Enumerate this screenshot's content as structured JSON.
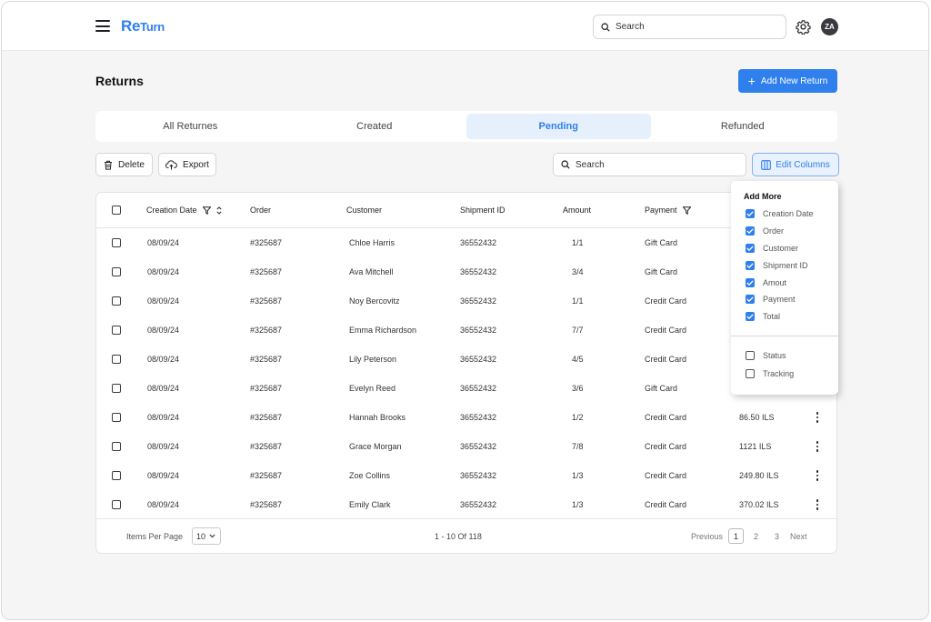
{
  "app": {
    "logo_main": "Re",
    "logo_small": "Turn"
  },
  "header": {
    "search_placeholder": "Search",
    "avatar_initials": "ZA"
  },
  "page": {
    "title": "Returns",
    "add_button_label": "Add New Return"
  },
  "tabs": [
    {
      "label": "All Returnes",
      "active": false
    },
    {
      "label": "Created",
      "active": false
    },
    {
      "label": "Pending",
      "active": true
    },
    {
      "label": "Refunded",
      "active": false
    }
  ],
  "toolbar": {
    "delete_label": "Delete",
    "export_label": "Export",
    "search_placeholder": "Search",
    "edit_columns_label": "Edit Columns"
  },
  "table": {
    "columns": {
      "creation_date": "Creation Date",
      "order": "Order",
      "customer": "Customer",
      "shipment_id": "Shipment ID",
      "amount": "Amount",
      "payment": "Payment"
    },
    "rows": [
      {
        "date": "08/09/24",
        "order": "#325687",
        "customer": "Chloe Harris",
        "shipment": "36552432",
        "amount": "1/1",
        "payment": "Gift Card",
        "total": ""
      },
      {
        "date": "08/09/24",
        "order": "#325687",
        "customer": "Ava Mitchell",
        "shipment": "36552432",
        "amount": "3/4",
        "payment": "Gift Card",
        "total": ""
      },
      {
        "date": "08/09/24",
        "order": "#325687",
        "customer": "Noy Bercovitz",
        "shipment": "36552432",
        "amount": "1/1",
        "payment": "Credit Card",
        "total": ""
      },
      {
        "date": "08/09/24",
        "order": "#325687",
        "customer": "Emma Richardson",
        "shipment": "36552432",
        "amount": "7/7",
        "payment": "Credit Card",
        "total": ""
      },
      {
        "date": "08/09/24",
        "order": "#325687",
        "customer": "Lily Peterson",
        "shipment": "36552432",
        "amount": "4/5",
        "payment": "Credit Card",
        "total": ""
      },
      {
        "date": "08/09/24",
        "order": "#325687",
        "customer": "Evelyn Reed",
        "shipment": "36552432",
        "amount": "3/6",
        "payment": "Gift Card",
        "total": ""
      },
      {
        "date": "08/09/24",
        "order": "#325687",
        "customer": "Hannah Brooks",
        "shipment": "36552432",
        "amount": "1/2",
        "payment": "Credit Card",
        "total": "86.50 ILS"
      },
      {
        "date": "08/09/24",
        "order": "#325687",
        "customer": "Grace Morgan",
        "shipment": "36552432",
        "amount": "7/8",
        "payment": "Credit Card",
        "total": "1121 ILS"
      },
      {
        "date": "08/09/24",
        "order": "#325687",
        "customer": "Zoe Collins",
        "shipment": "36552432",
        "amount": "1/3",
        "payment": "Credit Card",
        "total": "249.80 ILS"
      },
      {
        "date": "08/09/24",
        "order": "#325687",
        "customer": "Emily Clark",
        "shipment": "36552432",
        "amount": "1/3",
        "payment": "Credit Card",
        "total": "370.02 ILS"
      }
    ]
  },
  "footer": {
    "items_per_page_label": "Items Per Page",
    "items_per_page_value": "10",
    "range_text": "1 - 10 Of 118",
    "previous_label": "Previous",
    "pages": [
      "1",
      "2",
      "3"
    ],
    "current_page": "1",
    "next_label": "Next"
  },
  "column_menu": {
    "title": "Add More",
    "checked": [
      "Creation Date",
      "Order",
      "Customer",
      "Shipment ID",
      "Amout",
      "Payment",
      "Total"
    ],
    "unchecked": [
      "Status",
      "Tracking"
    ]
  },
  "colors": {
    "accent": "#2f80ed",
    "accent_light": "#e6f0fd",
    "background": "#f5f5f6"
  },
  "icons": [
    "menu-icon",
    "search-icon",
    "gear-icon",
    "plus-icon",
    "trash-icon",
    "cloud-upload-icon",
    "columns-icon",
    "filter-icon",
    "sort-icon",
    "kebab-icon",
    "chevron-down-icon",
    "check-icon"
  ]
}
